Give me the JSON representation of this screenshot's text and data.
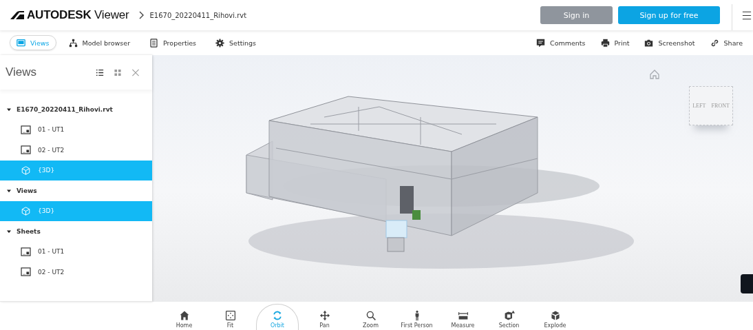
{
  "header": {
    "logo_bold": "AUTODESK",
    "logo_light": "Viewer",
    "file_name": "E1670_20220411_Rihovi.rvt",
    "buttons": [
      {
        "label": "Sign in",
        "kind": "secondary"
      },
      {
        "label": "Sign up for free",
        "kind": "primary"
      }
    ]
  },
  "tabs": [
    {
      "label": "Views",
      "selected": true
    },
    {
      "label": "Model browser",
      "selected": false
    },
    {
      "label": "Properties",
      "selected": false
    },
    {
      "label": "Settings",
      "selected": false
    }
  ],
  "actions": [
    {
      "label": "Comments"
    },
    {
      "label": "Print"
    },
    {
      "label": "Screenshot"
    },
    {
      "label": "Share"
    }
  ],
  "sidebar": {
    "title": "Views",
    "tree": [
      {
        "label": "E1670_20220411_Rihovi.rvt",
        "kind": "group",
        "expanded": true,
        "children": [
          {
            "label": "01 - UT1",
            "kind": "sheet",
            "selected": false
          },
          {
            "label": "02 - UT2",
            "kind": "sheet",
            "selected": false
          },
          {
            "label": "{3D}",
            "kind": "view3d",
            "selected": true
          }
        ]
      },
      {
        "label": "Views",
        "kind": "group",
        "expanded": true,
        "children": [
          {
            "label": "{3D}",
            "kind": "view3d",
            "selected": true
          }
        ]
      },
      {
        "label": "Sheets",
        "kind": "group",
        "expanded": true,
        "children": [
          {
            "label": "01 - UT1",
            "kind": "sheet",
            "selected": false
          },
          {
            "label": "02 - UT2",
            "kind": "sheet",
            "selected": false
          }
        ]
      }
    ]
  },
  "viewcube": {
    "left": "LEFT",
    "front": "FRONT"
  },
  "tools": [
    {
      "label": "Home",
      "selected": false
    },
    {
      "label": "Fit",
      "selected": false
    },
    {
      "label": "Orbit",
      "selected": true
    },
    {
      "label": "Pan",
      "selected": false
    },
    {
      "label": "Zoom",
      "selected": false
    },
    {
      "label": "First Person",
      "selected": false
    },
    {
      "label": "Measure",
      "selected": false
    },
    {
      "label": "Section",
      "selected": false
    },
    {
      "label": "Explode",
      "selected": false
    }
  ]
}
